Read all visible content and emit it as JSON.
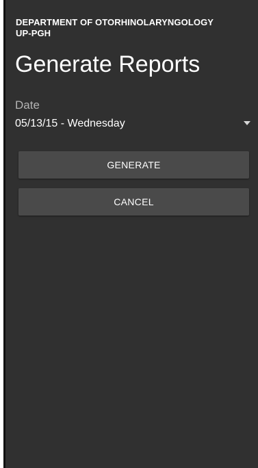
{
  "header": {
    "org_line1": "DEPARTMENT OF OTORHINOLARYNGOLOGY",
    "org_line2": "UP-PGH",
    "title": "Generate Reports"
  },
  "form": {
    "date_label": "Date",
    "date_value": "05/13/15 - Wednesday",
    "date_dropdown_icon": "triangle-down-icon"
  },
  "actions": {
    "generate_label": "GENERATE",
    "cancel_label": "CANCEL"
  },
  "colors": {
    "background": "#303030",
    "button": "#4a4a4a",
    "label_muted": "#b4b4b4",
    "text": "#ffffff"
  }
}
